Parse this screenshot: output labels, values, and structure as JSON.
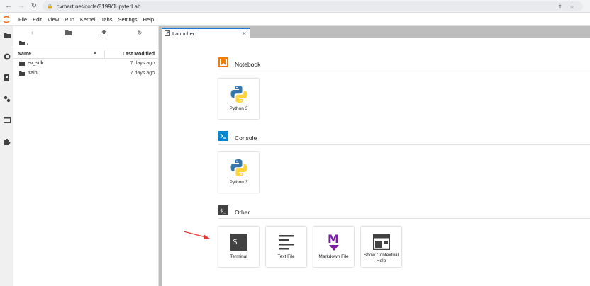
{
  "browser": {
    "url": "cvmart.net/code/8199/JupyterLab"
  },
  "menu": [
    "File",
    "Edit",
    "View",
    "Run",
    "Kernel",
    "Tabs",
    "Settings",
    "Help"
  ],
  "filebrowser": {
    "breadcrumb": "/",
    "col_name": "Name",
    "col_modified": "Last Modified",
    "rows": [
      {
        "name": "ev_sdk",
        "modified": "7 days ago"
      },
      {
        "name": "train",
        "modified": "7 days ago"
      }
    ]
  },
  "tab": {
    "label": "Launcher"
  },
  "launcher": {
    "sections": {
      "notebook": {
        "label": "Notebook",
        "cards": [
          "Python 3"
        ]
      },
      "console": {
        "label": "Console",
        "cards": [
          "Python 3"
        ]
      },
      "other": {
        "label": "Other",
        "cards": [
          "Terminal",
          "Text File",
          "Markdown File",
          "Show Contextual Help"
        ]
      }
    },
    "other_terminal_icon_text": "$_",
    "markdown_icon_letter": "M"
  },
  "colors": {
    "accent": "#1976d2",
    "notebook_orange": "#f57c00",
    "console_blue": "#0288d1",
    "markdown_purple": "#7b1fa2",
    "annotation_red": "#e53935"
  }
}
